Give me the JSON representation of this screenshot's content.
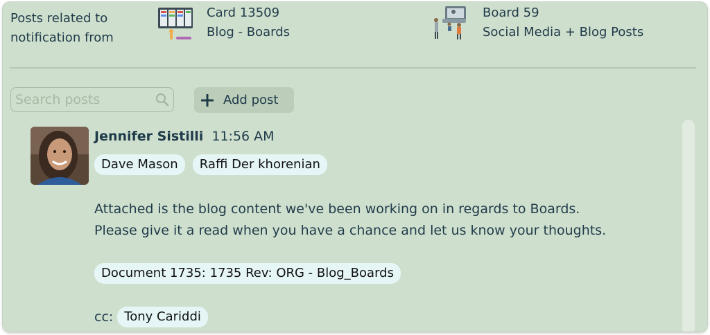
{
  "header": {
    "label_line1": "Posts related to",
    "label_line2": "notification from",
    "card": {
      "title": "Card 13509",
      "subtitle": "Blog - Boards",
      "icon": "kanban-board-icon"
    },
    "board": {
      "title": "Board 59",
      "subtitle": "Social Media + Blog Posts",
      "icon": "team-meeting-icon"
    }
  },
  "toolbar": {
    "search_placeholder": "Search posts",
    "search_value": "",
    "add_post_label": "Add post"
  },
  "post": {
    "author": "Jennifer Sistilli",
    "time": "11:56 AM",
    "mentions": [
      "Dave Mason",
      "Raffi Der khorenian"
    ],
    "body_line1": "Attached is the blog content we've been working on in regards to Boards.",
    "body_line2": "Please give it a read when you have a chance and let us know your thoughts.",
    "attachment": "Document 1735: 1735 Rev: ORG - Blog_Boards",
    "cc_label": "cc:",
    "cc": [
      "Tony Cariddi"
    ]
  },
  "colors": {
    "panel_bg": "#cfdfcd",
    "text": "#1f3b4a",
    "chip_bg": "#e6f6f7",
    "button_bg": "#bccdba"
  }
}
